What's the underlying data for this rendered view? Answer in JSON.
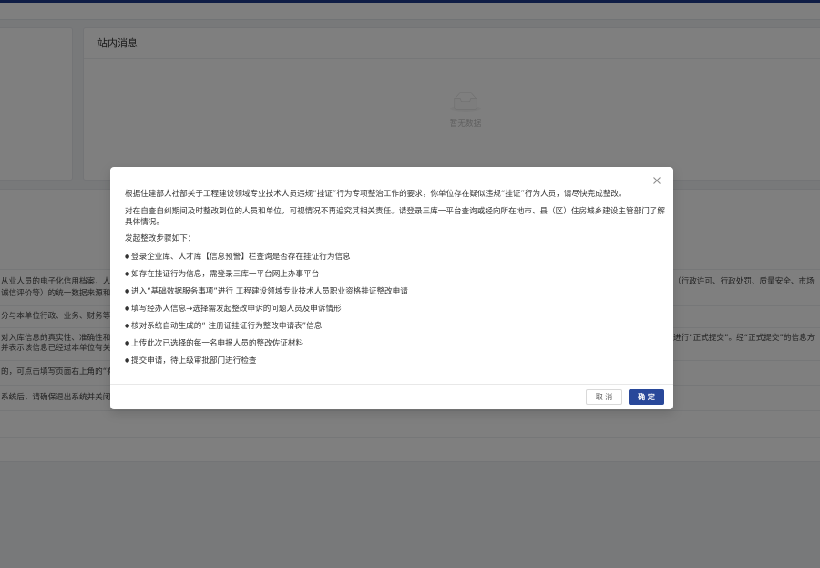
{
  "colors": {
    "accent": "#1f3a8a",
    "primary_button": "#29489a"
  },
  "messages_card": {
    "title": "站内消息",
    "empty_icon": "inbox-empty-icon",
    "empty_text": "暂无数据"
  },
  "notes": {
    "rows": [
      {
        "left": [
          "从业人员的电子化信用档案，人",
          "诚信评价等）的统一数据来源和"
        ],
        "right": [
          "（行政许可、行政处罚、质量安全、市场"
        ]
      },
      {
        "left": [
          "分与本单位行政、业务、财务等"
        ],
        "right": []
      },
      {
        "left": [
          "对入库信息的真实性、准确性和",
          "并表示该信息已经过本单位有关"
        ],
        "right": [
          "进行“正式提交”。经“正式提交”的信息方"
        ]
      },
      {
        "left": [
          "的，可点击填写页面右上角的“有"
        ],
        "right": []
      },
      {
        "left": [
          "系统后，请确保退出系统并关闭"
        ],
        "right": []
      }
    ]
  },
  "modal": {
    "close_icon": "close-icon",
    "paragraphs": [
      "根据住建部人社部关于工程建设领域专业技术人员违规“挂证”行为专项整治工作的要求，你单位存在疑似违规“挂证”行为人员，请尽快完成整改。",
      "对在自查自纠期间及时整改到位的人员和单位，可视情况不再追究其相关责任。请登录三库一平台查询或经向所在地市、县（区）住房城乡建设主管部门了解具体情况。"
    ],
    "steps_heading": "发起整改步骤如下：",
    "marker": "●",
    "steps": [
      "登录企业库、人才库【信息预警】栏查询是否存在挂证行为信息",
      "如存在挂证行为信息，需登录三库一平台网上办事平台",
      "进入“基础数据服务事项”进行 工程建设领域专业技术人员职业资格挂证整改申请",
      "填写经办人信息→选择需发起整改申诉的问题人员及申诉情形",
      "核对系统自动生成的“ 注册证挂证行为整改申请表”信息",
      "上传此次已选择的每一名申报人员的整改佐证材料",
      "提交申请，待上级审批部门进行检查"
    ],
    "cancel_label": "取 消",
    "confirm_label": "确 定"
  }
}
